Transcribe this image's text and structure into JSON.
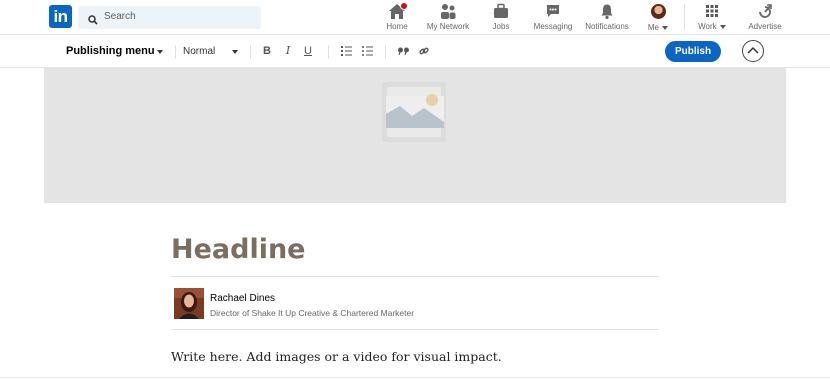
{
  "nav": {
    "search_placeholder": "Search",
    "items": [
      {
        "label": "Home",
        "icon": "home-icon"
      },
      {
        "label": "My Network",
        "icon": "network-icon"
      },
      {
        "label": "Jobs",
        "icon": "briefcase-icon"
      },
      {
        "label": "Messaging",
        "icon": "messaging-icon"
      },
      {
        "label": "Notifications",
        "icon": "bell-icon"
      },
      {
        "label": "Me",
        "icon": "avatar"
      },
      {
        "label": "Work",
        "icon": "grid-icon"
      },
      {
        "label": "Advertise",
        "icon": "advertise-icon"
      }
    ],
    "brand_color": "#0a66c2"
  },
  "toolbar": {
    "publishing_menu": "Publishing menu",
    "style_select": "Normal",
    "bold": "B",
    "italic": "I",
    "underline": "U",
    "publish_label": "Publish"
  },
  "article": {
    "headline": "Headline",
    "author_name": "Rachael Dines",
    "author_title": "Director of Shake It Up Creative & Chartered Marketer",
    "body_placeholder": "Write here. Add images or a video for visual impact."
  }
}
